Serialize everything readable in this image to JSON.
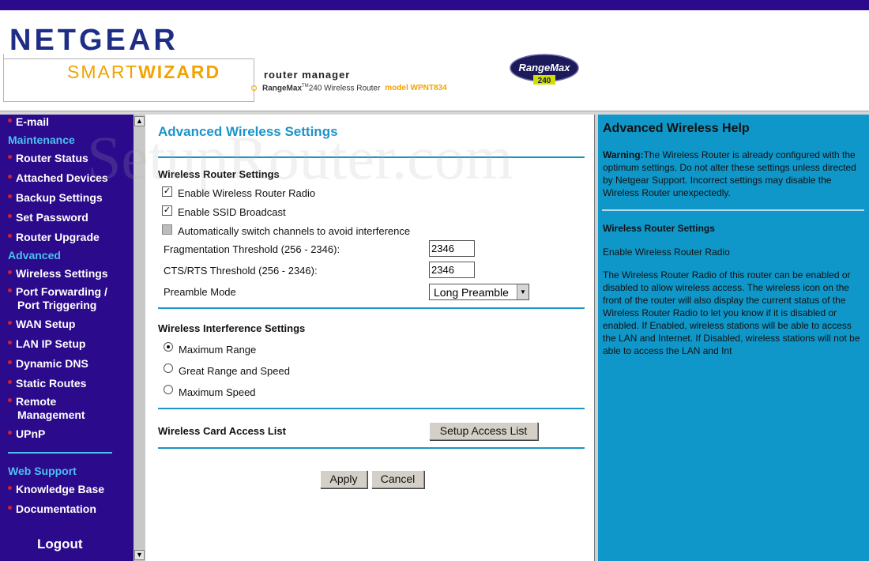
{
  "header": {
    "logo_text": "NETGEAR",
    "wizard_text_light": "SMART",
    "wizard_text_bold": "WIZARD",
    "product_title": "router manager",
    "product_name_bold": "RangeMax",
    "product_name_tm": "TM",
    "product_rest": "240 Wireless Router",
    "model_label": "model WPNT834",
    "badge_text": "RangeMax",
    "badge_number": "240"
  },
  "sidebar": {
    "items": [
      {
        "label": "E-mail",
        "type": "link"
      },
      {
        "label": "Maintenance",
        "type": "heading"
      },
      {
        "label": "Router Status",
        "type": "link"
      },
      {
        "label": "Attached Devices",
        "type": "link"
      },
      {
        "label": "Backup Settings",
        "type": "link"
      },
      {
        "label": "Set Password",
        "type": "link"
      },
      {
        "label": "Router Upgrade",
        "type": "link"
      },
      {
        "label": "Advanced",
        "type": "heading"
      },
      {
        "label": "Wireless Settings",
        "type": "link"
      },
      {
        "label": "Port Forwarding /",
        "label2": "Port Triggering",
        "type": "link"
      },
      {
        "label": "WAN Setup",
        "type": "link"
      },
      {
        "label": "LAN IP Setup",
        "type": "link"
      },
      {
        "label": "Dynamic DNS",
        "type": "link"
      },
      {
        "label": "Static Routes",
        "type": "link"
      },
      {
        "label": "Remote",
        "label2": "Management",
        "type": "link"
      },
      {
        "label": "UPnP",
        "type": "link"
      },
      {
        "label": "Web Support",
        "type": "heading"
      },
      {
        "label": "Knowledge Base",
        "type": "link"
      },
      {
        "label": "Documentation",
        "type": "link"
      }
    ],
    "logout": "Logout"
  },
  "main": {
    "title": "Advanced Wireless Settings",
    "router_section": {
      "title": "Wireless Router Settings",
      "enable_radio": {
        "label": "Enable Wireless Router Radio",
        "checked": true
      },
      "enable_ssid": {
        "label": "Enable SSID Broadcast",
        "checked": true
      },
      "auto_channel": {
        "label": "Automatically switch channels to avoid interference",
        "checked": false,
        "disabled": true
      },
      "frag_label": "Fragmentation Threshold (256 - 2346):",
      "frag_value": "2346",
      "cts_label": "CTS/RTS Threshold (256 - 2346):",
      "cts_value": "2346",
      "preamble_label": "Preamble Mode",
      "preamble_value": "Long Preamble"
    },
    "interference_section": {
      "title": "Wireless Interference Settings",
      "options": [
        {
          "label": "Maximum Range",
          "selected": true
        },
        {
          "label": "Great Range and Speed",
          "selected": false
        },
        {
          "label": "Maximum Speed",
          "selected": false
        }
      ]
    },
    "access_list": {
      "title": "Wireless Card Access List",
      "button": "Setup Access List"
    },
    "apply": "Apply",
    "cancel": "Cancel"
  },
  "help": {
    "title": "Advanced Wireless Help",
    "warning_label": "Warning:",
    "warning_text": "The Wireless Router is already configured with the optimum settings. Do not alter these settings unless directed by Netgear Support. Incorrect settings may disable the Wireless Router unexpectedly.",
    "sub_title": "Wireless Router Settings",
    "sub_item": "Enable Wireless Router Radio",
    "body": "The Wireless Router Radio of this router can be enabled or disabled to allow wireless access. The wireless icon on the front of the router will also display the current status of the Wireless Router Radio to let you know if it is disabled or enabled. If Enabled, wireless stations will be able to access the LAN and Internet. If Disabled, wireless stations will not be able to access the LAN and Int"
  },
  "watermark": "SetupRouter.com",
  "colors": {
    "sidebar_bg": "#2b0a8c",
    "heading_blue": "#4cc0f2",
    "title_blue": "#1b94c9",
    "help_bg": "#0f97c9",
    "bullet_red": "#d4202c",
    "brand_orange": "#f2a300",
    "brand_navy": "#1e2e86"
  }
}
